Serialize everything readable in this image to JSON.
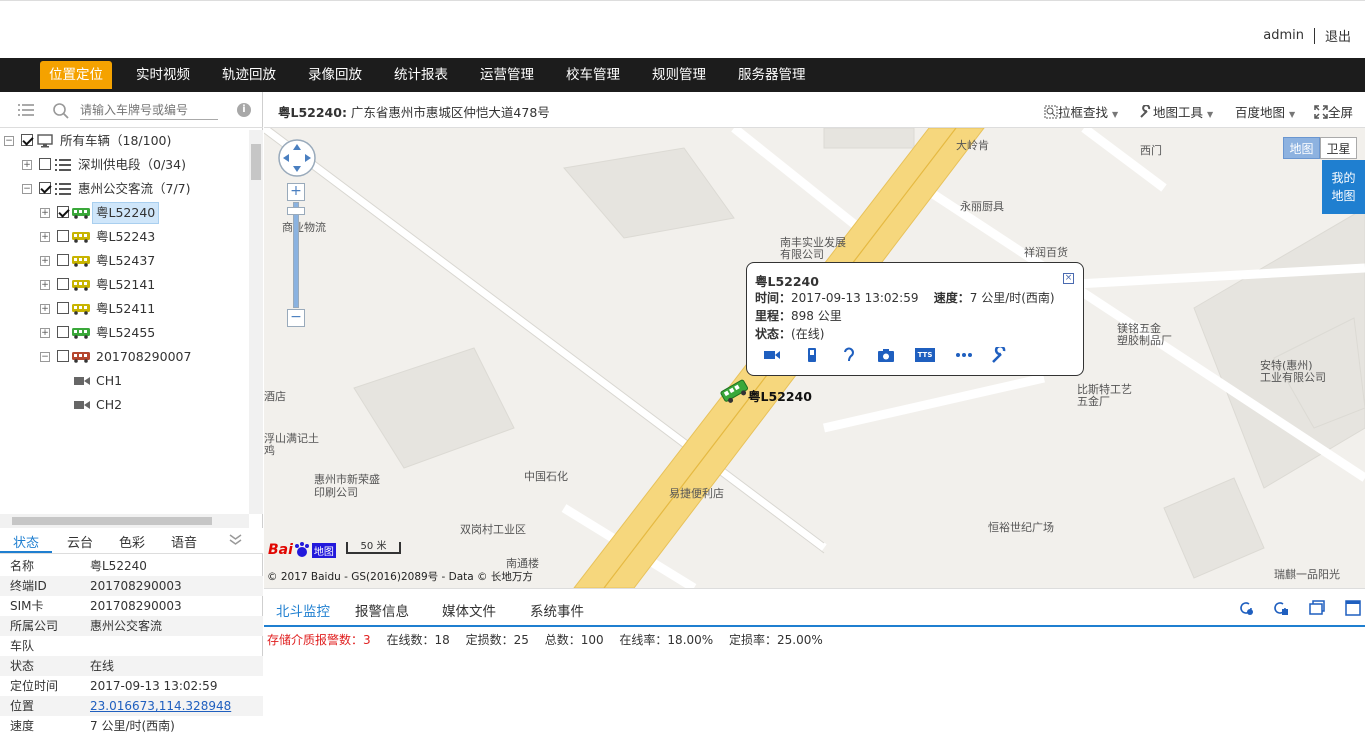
{
  "user": {
    "name": "admin",
    "logout": "退出"
  },
  "nav": [
    {
      "label": "位置定位",
      "active": true
    },
    {
      "label": "实时视频"
    },
    {
      "label": "轨迹回放"
    },
    {
      "label": "录像回放"
    },
    {
      "label": "统计报表"
    },
    {
      "label": "运营管理"
    },
    {
      "label": "校车管理"
    },
    {
      "label": "规则管理"
    },
    {
      "label": "服务器管理"
    }
  ],
  "search": {
    "placeholder": "请输入车牌号或编号"
  },
  "tree": {
    "root": "所有车辆（18/100)",
    "group1": "深圳供电段（0/34)",
    "group2": "惠州公交客流（7/7)",
    "vehicles": [
      "粤L52240",
      "粤L52243",
      "粤L52437",
      "粤L52141",
      "粤L52411",
      "粤L52455",
      "201708290007"
    ],
    "channels": [
      "CH1",
      "CH2"
    ]
  },
  "detail_tabs": [
    "状态",
    "云台",
    "色彩",
    "语音"
  ],
  "props": [
    {
      "k": "名称",
      "v": "粤L52240"
    },
    {
      "k": "终端ID",
      "v": "201708290003"
    },
    {
      "k": "SIM卡",
      "v": "201708290003"
    },
    {
      "k": "所属公司",
      "v": "惠州公交客流"
    },
    {
      "k": "车队",
      "v": ""
    },
    {
      "k": "状态",
      "v": "在线"
    },
    {
      "k": "定位时间",
      "v": "2017-09-13 13:02:59"
    },
    {
      "k": "位置",
      "v": "23.016673,114.328948"
    },
    {
      "k": "速度",
      "v": "7 公里/时(西南)"
    }
  ],
  "maphead": {
    "plate": "粤L52240:",
    "address": " 广东省惠州市惠城区仲恺大道478号",
    "tools": [
      "拉框查找",
      "地图工具",
      "百度地图",
      "全屏"
    ]
  },
  "map": {
    "type_map": "地图",
    "type_sat": "卫星",
    "mine": [
      "我的",
      "地图"
    ],
    "scale": "50 米",
    "copyright": "© 2017 Baidu - GS(2016)2089号 - Data © 长地万方",
    "vehicle_label": "粤L52240",
    "labels": [
      "大岭肯",
      "西门",
      "永丽厨具",
      "南丰实业发展",
      "有限公司",
      "祥润百货",
      "商业物流",
      "镁铭五金",
      "塑胶制品厂",
      "安特(惠州)",
      "工业有限公司",
      "比斯特工艺",
      "五金厂",
      "中国石化",
      "易捷便利店",
      "惠州市新荣盛",
      "印刷公司",
      "双岗村工业区",
      "南通楼",
      "恒裕世纪广场",
      "瑞麒一品阳光",
      "浮山满记土",
      "鸡",
      "酒店"
    ]
  },
  "popup": {
    "title": "粤L52240",
    "time_k": "时间：",
    "time_v": "2017-09-13 13:02:59",
    "speed_k": "速度：",
    "speed_v": "7 公里/时(西南)",
    "mileage_k": "里程：",
    "mileage_v": "898 公里",
    "status_k": "状态：",
    "status_v": "(在线)",
    "tts": "TTS"
  },
  "bottom": {
    "tabs": [
      "北斗监控",
      "报警信息",
      "媒体文件",
      "系统事件"
    ],
    "warn": "存储介质报警数：3",
    "online": "在线数：18",
    "located": "定损数：25",
    "total": "总数：100",
    "online_rate": "在线率：18.00%",
    "loc_rate": "定损率：25.00%"
  },
  "colors": {
    "accent": "#f5a200",
    "blue": "#1f7fd0",
    "nav_bg": "#1c1c1c"
  }
}
